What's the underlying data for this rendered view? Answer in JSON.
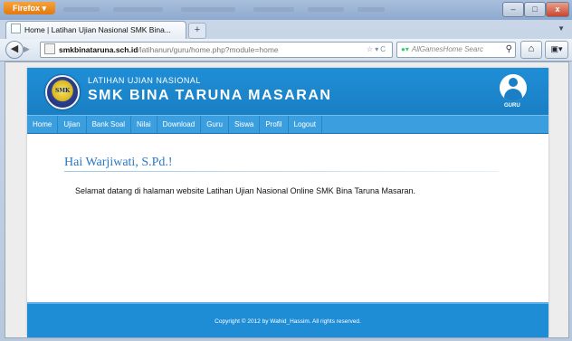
{
  "browser": {
    "app_button": "Firefox ▾",
    "tab_title": "Home | Latihan Ujian Nasional SMK Bina...",
    "new_tab": "+",
    "url_host": "smkbinataruna.sch.id",
    "url_path": "/latihanun/guru/home.php?module=home",
    "search_placeholder": "AllGamesHome Searc",
    "window_controls": {
      "minimize": "–",
      "maximize": "□",
      "close": "x"
    }
  },
  "site": {
    "subtitle": "LATIHAN UJIAN NASIONAL",
    "title": "SMK BINA TARUNA MASARAN",
    "logo_text": "SMK",
    "user_role": "GURU"
  },
  "menu": {
    "items": [
      "Home",
      "Ujian",
      "Bank Soal",
      "Nilai",
      "Download",
      "Guru",
      "Siswa",
      "Profil",
      "Logout"
    ]
  },
  "main": {
    "greeting": "Hai Warjiwati, S.Pd.!",
    "welcome": "Selamat datang di halaman website Latihan Ujian Nasional Online SMK Bina Taruna Masaran."
  },
  "footer": {
    "copyright": "Copyright © 2012 by Wahid_Hassim. All rights reserved."
  },
  "colors": {
    "header_blue": "#1a7fc4",
    "menu_blue": "#3b9fdf",
    "greeting_blue": "#2a77c4"
  }
}
